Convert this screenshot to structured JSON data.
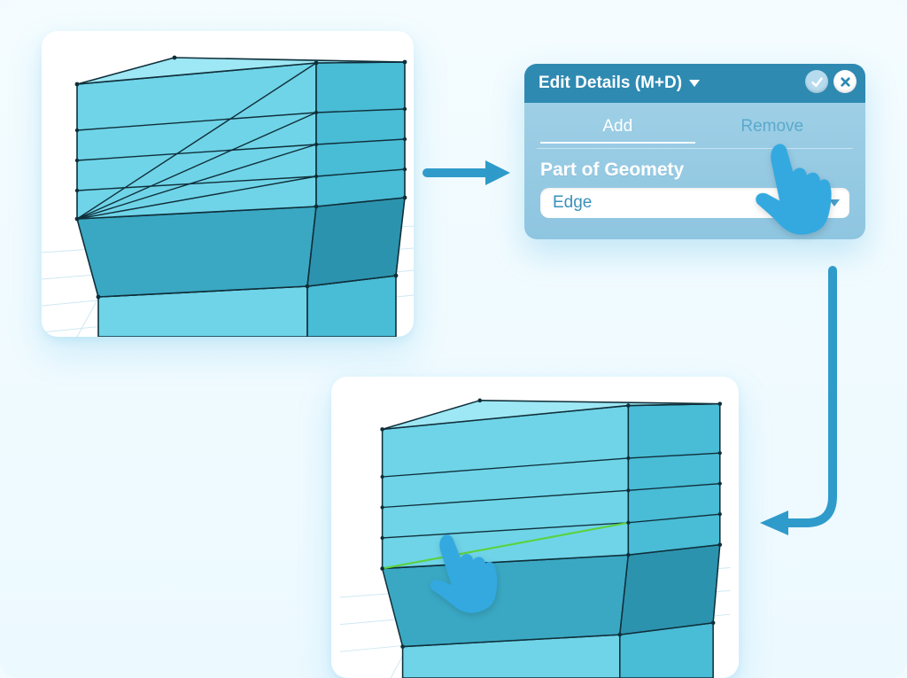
{
  "panel": {
    "title": "Edit Details (M+D)",
    "tabs": {
      "add": "Add",
      "remove": "Remove",
      "active": "add"
    },
    "section_label": "Part of Geomety",
    "dropdown_value": "Edge"
  },
  "colors": {
    "mesh_fill_light": "#6fd4e8",
    "mesh_fill_mid": "#49bcd6",
    "mesh_fill_dark": "#2fa3bf",
    "mesh_edge": "#0f2f3a",
    "highlight_edge": "#5bd23c",
    "panel_header": "#2f8ab2",
    "panel_body": "#9ecfe6",
    "hand": "#33a9e0",
    "arrow": "#2f9bca"
  },
  "step_arrows": {
    "a_to_panel": "right",
    "panel_to_b": "down-left"
  }
}
